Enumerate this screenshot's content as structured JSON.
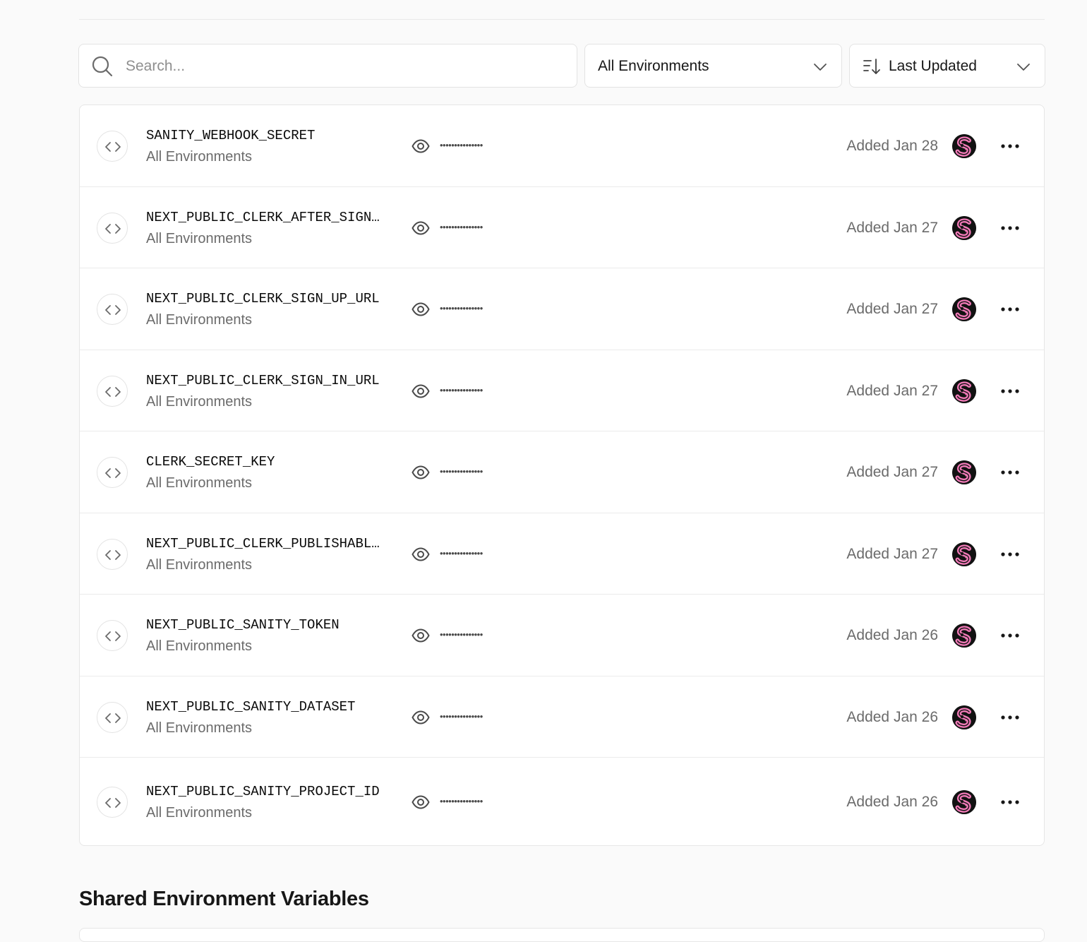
{
  "search": {
    "placeholder": "Search...",
    "value": ""
  },
  "filters": {
    "environment_label": "All Environments",
    "sort_label": "Last Updated"
  },
  "variables": [
    {
      "name": "SANITY_WEBHOOK_SECRET",
      "environment": "All Environments",
      "masked_value": "•••••••••••••••",
      "added": "Added Jan 28"
    },
    {
      "name": "NEXT_PUBLIC_CLERK_AFTER_SIGN…",
      "environment": "All Environments",
      "masked_value": "•••••••••••••••",
      "added": "Added Jan 27"
    },
    {
      "name": "NEXT_PUBLIC_CLERK_SIGN_UP_URL",
      "environment": "All Environments",
      "masked_value": "•••••••••••••••",
      "added": "Added Jan 27"
    },
    {
      "name": "NEXT_PUBLIC_CLERK_SIGN_IN_URL",
      "environment": "All Environments",
      "masked_value": "•••••••••••••••",
      "added": "Added Jan 27"
    },
    {
      "name": "CLERK_SECRET_KEY",
      "environment": "All Environments",
      "masked_value": "•••••••••••••••",
      "added": "Added Jan 27"
    },
    {
      "name": "NEXT_PUBLIC_CLERK_PUBLISHABL…",
      "environment": "All Environments",
      "masked_value": "•••••••••••••••",
      "added": "Added Jan 27"
    },
    {
      "name": "NEXT_PUBLIC_SANITY_TOKEN",
      "environment": "All Environments",
      "masked_value": "•••••••••••••••",
      "added": "Added Jan 26"
    },
    {
      "name": "NEXT_PUBLIC_SANITY_DATASET",
      "environment": "All Environments",
      "masked_value": "•••••••••••••••",
      "added": "Added Jan 26"
    },
    {
      "name": "NEXT_PUBLIC_SANITY_PROJECT_ID",
      "environment": "All Environments",
      "masked_value": "•••••••••••••••",
      "added": "Added Jan 26"
    }
  ],
  "shared_section": {
    "title": "Shared Environment Variables"
  },
  "colors": {
    "background": "#fafafa",
    "card": "#ffffff",
    "border": "#e6e6e6",
    "text_primary": "#171717",
    "text_muted": "#6b6b6b",
    "avatar_accent": "#f27ab8"
  }
}
